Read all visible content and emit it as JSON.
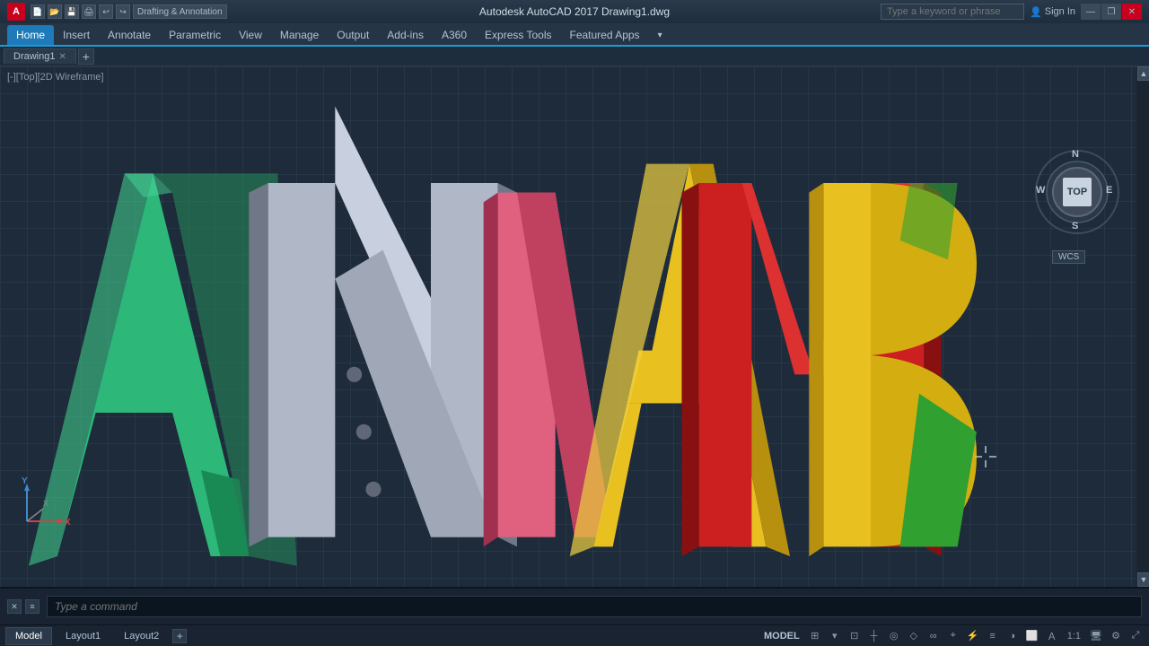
{
  "titleBar": {
    "appIcon": "A",
    "title": "Autodesk AutoCAD 2017  Drawing1.dwg",
    "searchPlaceholder": "Type a keyword or phrase",
    "signinLabel": "Sign In",
    "winControls": [
      "—",
      "❐",
      "✕"
    ],
    "toolIcons": [
      "💾",
      "📂",
      "⬛",
      "↩",
      "↪",
      "⬛",
      "✏️",
      "⬛",
      "⬛"
    ]
  },
  "workspaceDropdown": "Drafting & Annotation",
  "ribbonTabs": [
    {
      "label": "Home",
      "active": true
    },
    {
      "label": "Insert"
    },
    {
      "label": "Annotate"
    },
    {
      "label": "Parametric"
    },
    {
      "label": "View"
    },
    {
      "label": "Manage"
    },
    {
      "label": "Output"
    },
    {
      "label": "Add-ins"
    },
    {
      "label": "A360"
    },
    {
      "label": "Express Tools"
    },
    {
      "label": "Featured Apps"
    },
    {
      "label": "⬛"
    }
  ],
  "drawingTabs": [
    {
      "label": "Drawing1",
      "active": true
    }
  ],
  "viewportLabel": "[-][Top][2D Wireframe]",
  "compass": {
    "N": "N",
    "S": "S",
    "E": "E",
    "W": "W",
    "topLabel": "TOP"
  },
  "wcsLabel": "WCS",
  "statusTabs": [
    {
      "label": "Model",
      "active": true
    },
    {
      "label": "Layout1"
    },
    {
      "label": "Layout2"
    }
  ],
  "statusRight": {
    "model": "MODEL",
    "zoom": "1:1"
  },
  "commandPrompt": "Type a command",
  "cmdIcons": [
    "✕",
    "⬛",
    "⬛"
  ]
}
